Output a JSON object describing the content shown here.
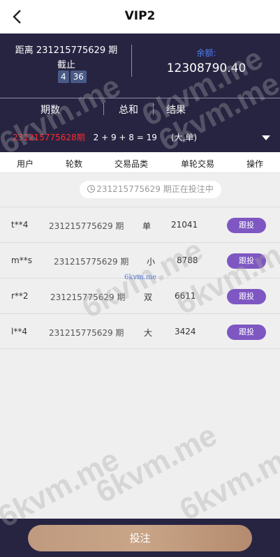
{
  "header": {
    "title": "VIP2",
    "back_icon": "chevron-left-icon"
  },
  "info": {
    "period_line": "距离 231215775629 期",
    "cutoff_label": "截止",
    "countdown": [
      "4",
      "36"
    ],
    "balance_label": "余额:",
    "balance_value": "12308790.40"
  },
  "results": {
    "columns": [
      "期数",
      "总和",
      "结果"
    ],
    "latest_period": "231215775628期",
    "sum_expression": "2 + 9 + 8 = 19",
    "outcome": "(大,单)",
    "caret_icon": "caret-down-icon"
  },
  "tabs": [
    "用户",
    "轮数",
    "交易品类",
    "单轮交易",
    "操作"
  ],
  "status": {
    "text": "231215775629 期正在投注中",
    "icon": "clock-icon"
  },
  "bets": [
    {
      "user": "t**4",
      "period": "231215775629 期",
      "type": "单",
      "amount": "21041",
      "action": "跟投"
    },
    {
      "user": "m**s",
      "period": "231215775629 期",
      "type": "小",
      "amount": "8788",
      "action": "跟投"
    },
    {
      "user": "r**2",
      "period": "231215775629 期",
      "type": "双",
      "amount": "6611",
      "action": "跟投"
    },
    {
      "user": "l**4",
      "period": "231215775629 期",
      "type": "大",
      "amount": "3424",
      "action": "跟投"
    }
  ],
  "footer": {
    "submit_label": "投注"
  },
  "watermark": {
    "text": "6kvm.me",
    "small_text": "6kvm.me"
  },
  "colors": {
    "dark_panel": "#272442",
    "accent_red": "#ff2a2a",
    "follow_purple": "#7e57c2",
    "balance_blue": "#4f7ef0"
  }
}
